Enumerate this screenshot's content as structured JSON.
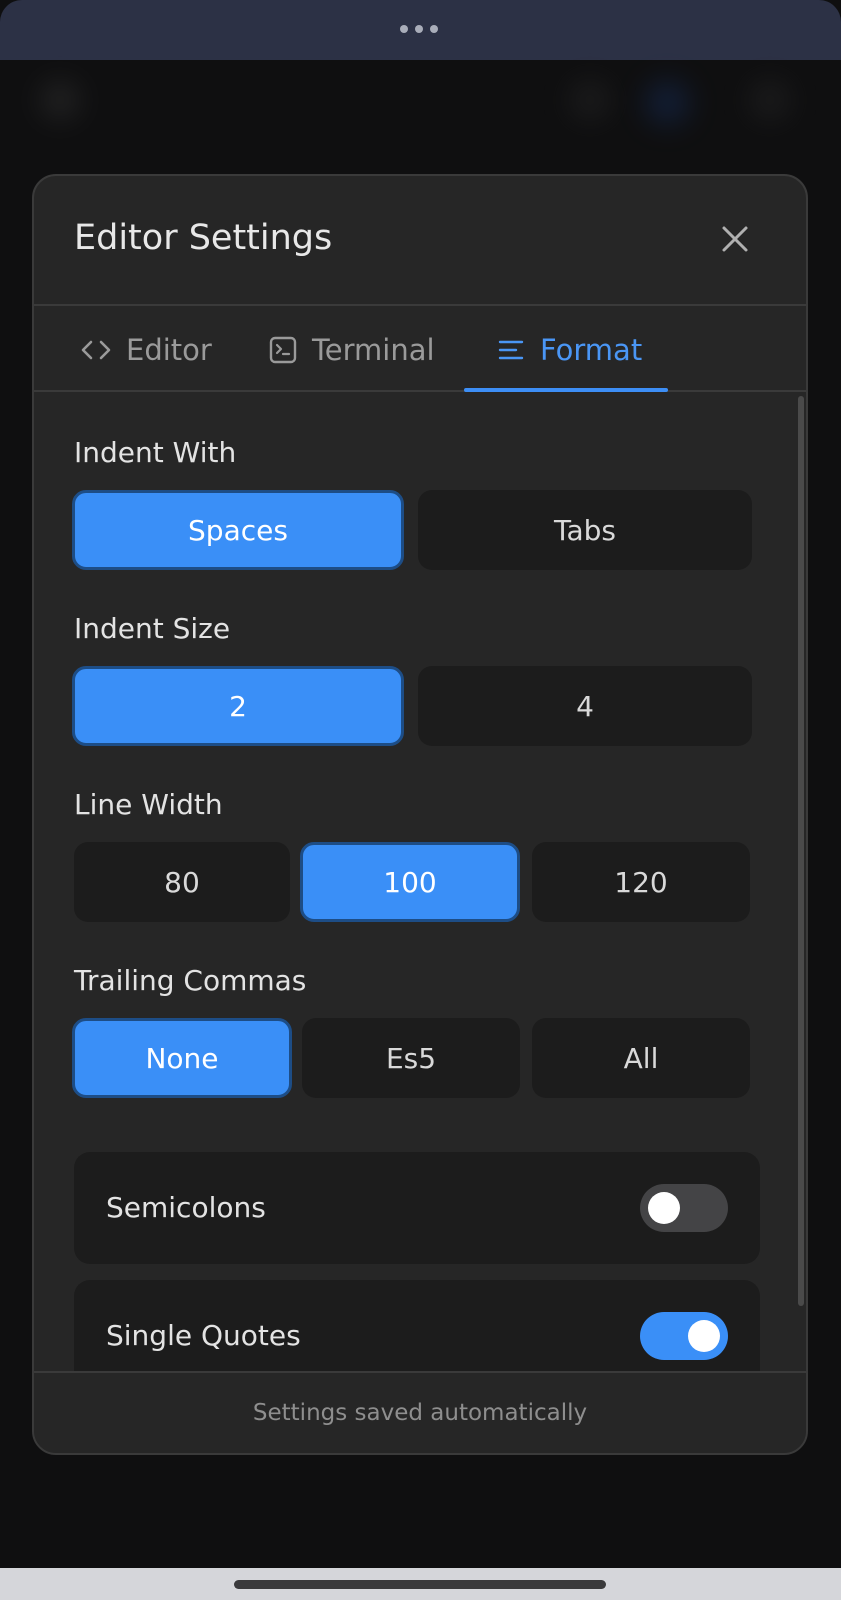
{
  "modal": {
    "title": "Editor Settings",
    "close_icon": "close-icon"
  },
  "tabs": [
    {
      "label": "Editor",
      "icon": "code-icon",
      "active": false
    },
    {
      "label": "Terminal",
      "icon": "terminal-icon",
      "active": false
    },
    {
      "label": "Format",
      "icon": "align-left-icon",
      "active": true
    }
  ],
  "sections": {
    "indent_with": {
      "label": "Indent With",
      "options": [
        "Spaces",
        "Tabs"
      ],
      "selected": "Spaces"
    },
    "indent_size": {
      "label": "Indent Size",
      "options": [
        "2",
        "4"
      ],
      "selected": "2"
    },
    "line_width": {
      "label": "Line Width",
      "options": [
        "80",
        "100",
        "120"
      ],
      "selected": "100"
    },
    "trailing_commas": {
      "label": "Trailing Commas",
      "options": [
        "None",
        "Es5",
        "All"
      ],
      "selected": "None"
    }
  },
  "toggles": {
    "semicolons": {
      "label": "Semicolons",
      "on": false
    },
    "single_quotes": {
      "label": "Single Quotes",
      "on": true
    }
  },
  "footer": {
    "text": "Settings saved automatically"
  },
  "colors": {
    "accent": "#3a8ff7",
    "background": "#262626",
    "option_bg": "#1c1c1c"
  }
}
